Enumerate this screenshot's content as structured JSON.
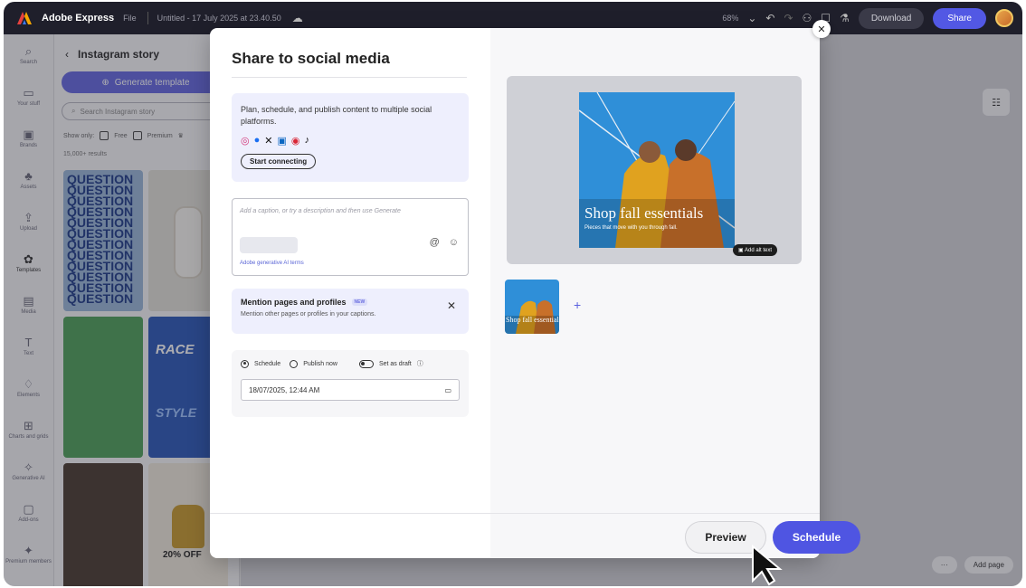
{
  "topbar": {
    "brand": "Adobe Express",
    "file_menu": "File",
    "doc_title": "Untitled - 17 July 2025 at 23.40.50",
    "zoom": "68%",
    "download_label": "Download",
    "share_label": "Share"
  },
  "rail": {
    "items": [
      {
        "label": "Search",
        "icon": "search-icon"
      },
      {
        "label": "Your stuff",
        "icon": "folder-icon"
      },
      {
        "label": "Brands",
        "icon": "brand-icon"
      },
      {
        "label": "Assets",
        "icon": "assets-icon"
      },
      {
        "label": "Upload",
        "icon": "upload-icon"
      },
      {
        "label": "Templates",
        "icon": "templates-icon"
      },
      {
        "label": "Media",
        "icon": "media-icon"
      },
      {
        "label": "Text",
        "icon": "text-icon"
      },
      {
        "label": "Elements",
        "icon": "elements-icon"
      },
      {
        "label": "Charts and grids",
        "icon": "chart-icon"
      },
      {
        "label": "Generative AI",
        "icon": "ai-icon"
      },
      {
        "label": "Add-ons",
        "icon": "addons-icon"
      },
      {
        "label": "Premium members",
        "icon": "premium-icon"
      }
    ]
  },
  "panel": {
    "title": "Instagram story",
    "generate_label": "Generate template",
    "search_placeholder": "Search Instagram story",
    "show_only": "Show only:",
    "free": "Free",
    "premium": "Premium",
    "results": "15,000+ results",
    "thumb_q_text": "QUESTION",
    "thumb_race_text": "RACE",
    "thumb_style_text": "STYLE",
    "thumb_sale_text": "20% OFF"
  },
  "canvas": {
    "add_page": "Add page"
  },
  "modal": {
    "title": "Share to social media",
    "plan_text": "Plan, schedule, and publish content to multiple social platforms.",
    "start_connecting": "Start connecting",
    "caption_placeholder": "Add a caption, or try a description and then use Generate",
    "genai_terms": "Adobe generative AI terms",
    "mention_title": "Mention pages and profiles",
    "mention_badge": "NEW",
    "mention_sub": "Mention other pages or profiles in your captions.",
    "schedule_label": "Schedule",
    "publish_now_label": "Publish now",
    "draft_label": "Set as draft",
    "date_value": "18/07/2025, 12:44 AM",
    "post_title": "Shop fall essentials",
    "post_subtitle": "Pieces that move with you through fall.",
    "alt_text_label": "Add alt text",
    "preview_label": "Preview",
    "schedule_button": "Schedule"
  },
  "colors": {
    "accent": "#4f55e2",
    "topbar": "#1f1f2b",
    "sky": "#2f8fd8",
    "coat": "#e0a21f"
  }
}
